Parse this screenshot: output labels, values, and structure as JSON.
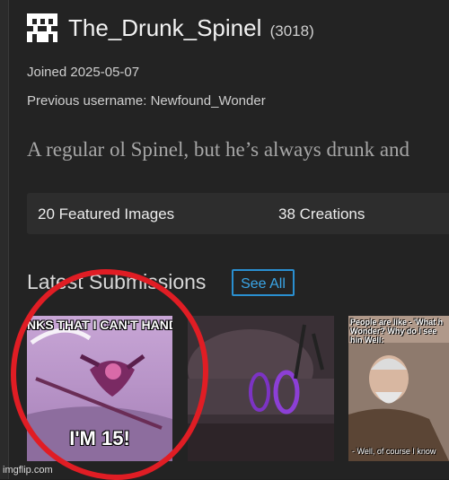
{
  "profile": {
    "username": "The_Drunk_Spinel",
    "points": "(3018)",
    "joined": "Joined 2025-05-07",
    "previous_username": "Previous username: Newfound_Wonder",
    "bio": "A regular ol Spinel, but he’s always drunk and"
  },
  "stats": {
    "featured": "20 Featured Images",
    "creations": "38 Creations"
  },
  "submissions": {
    "title": "Latest Submissions",
    "see_all": "See All",
    "items": [
      {
        "top_text": "NKS THAT I CAN'T HANDLE",
        "bottom_text": "I'M 15!"
      },
      {
        "top_text": "",
        "bottom_text": ""
      },
      {
        "top_text": "People are like - 'What h Wonder? Why do I see hin Well:",
        "bottom_text": "- Well, of course I know"
      }
    ]
  },
  "watermark": "imgflip.com",
  "colors": {
    "background": "#232323",
    "stats_bar": "#2d2d2d",
    "see_all_border": "#2a8fd0",
    "annotation_red": "#e01d24"
  }
}
